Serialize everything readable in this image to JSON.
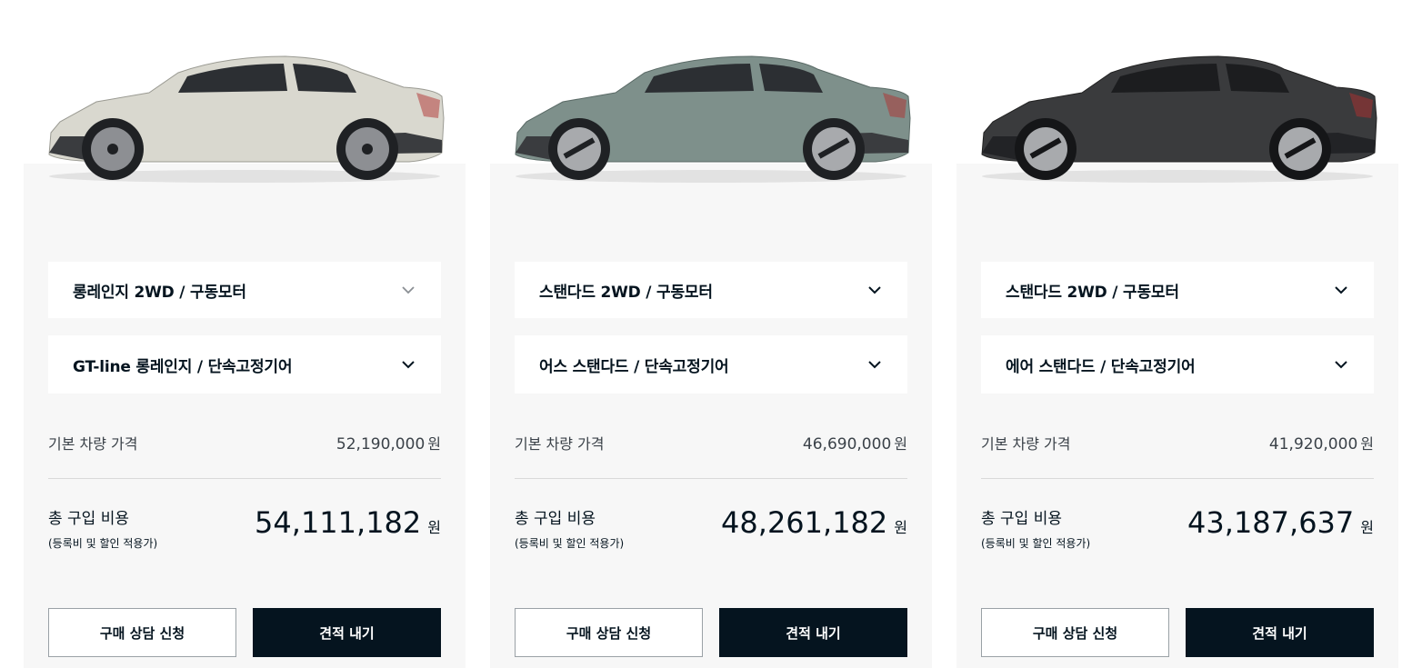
{
  "cards": [
    {
      "trim": "롱레인지 2WD / 구동모터",
      "variant": "GT-line 롱레인지 / 단속고정기어",
      "base_price_label": "기본 차량 가격",
      "base_price": "52,190,000",
      "base_price_unit": "원",
      "total_label": "총 구입 비용",
      "total_note": "(등록비 및 할인 적용가)",
      "total_price": "54,111,182",
      "total_unit": "원",
      "consult_button": "구매 상담 신청",
      "quote_button": "견적 내기",
      "car_color": "#d9d8cf"
    },
    {
      "trim": "스탠다드 2WD / 구동모터",
      "variant": "어스 스탠다드 / 단속고정기어",
      "base_price_label": "기본 차량 가격",
      "base_price": "46,690,000",
      "base_price_unit": "원",
      "total_label": "총 구입 비용",
      "total_note": "(등록비 및 할인 적용가)",
      "total_price": "48,261,182",
      "total_unit": "원",
      "consult_button": "구매 상담 신청",
      "quote_button": "견적 내기",
      "car_color": "#7e908b"
    },
    {
      "trim": "스탠다드 2WD / 구동모터",
      "variant": "에어 스탠다드 / 단속고정기어",
      "base_price_label": "기본 차량 가격",
      "base_price": "41,920,000",
      "base_price_unit": "원",
      "total_label": "총 구입 비용",
      "total_note": "(등록비 및 할인 적용가)",
      "total_price": "43,187,637",
      "total_unit": "원",
      "consult_button": "구매 상담 신청",
      "quote_button": "견적 내기",
      "car_color": "#3a3b3d"
    }
  ],
  "icons": {
    "dropdown": "chevron-down-icon"
  }
}
